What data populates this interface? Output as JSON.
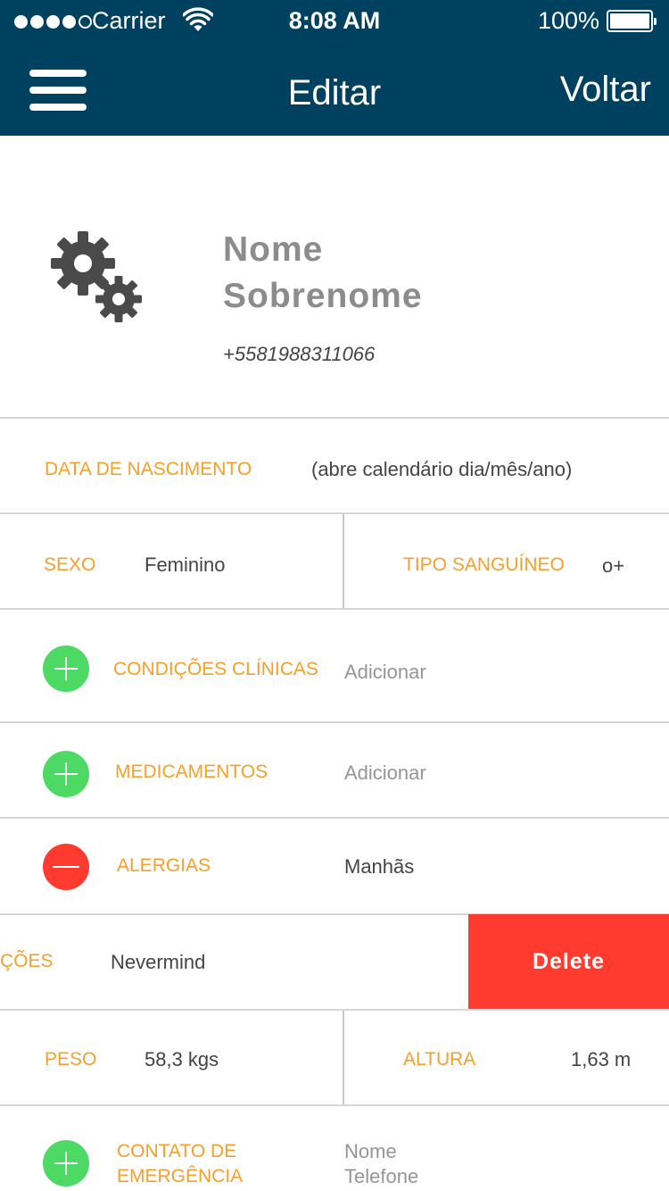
{
  "status_bar": {
    "carrier": "Carrier",
    "time": "8:08 AM",
    "battery": "100%"
  },
  "nav": {
    "title": "Editar",
    "back_label": "Voltar"
  },
  "profile": {
    "first_name": "Nome",
    "last_name": "Sobrenome",
    "phone": "+5581988311066",
    "icon": "gears-icon"
  },
  "birth_date": {
    "label": "DATA DE NASCIMENTO",
    "value": "(abre calendário dia/mês/ano)"
  },
  "sex": {
    "label": "SEXO",
    "value": "Feminino"
  },
  "blood_type": {
    "label": "TIPO SANGUÍNEO",
    "value": "o+"
  },
  "clinical_conditions": {
    "label": "CONDIÇÕES CLÍNICAS",
    "value": "Adicionar"
  },
  "medications": {
    "label": "MEDICAMENTOS",
    "value": "Adicionar"
  },
  "allergies": {
    "label": "ALERGIAS",
    "value": "Manhãs"
  },
  "swiped_row": {
    "label": "ÇÕES",
    "value": "Nevermind",
    "delete_label": "Delete"
  },
  "weight": {
    "label": "PESO",
    "value": "58,3 kgs"
  },
  "height": {
    "label": "ALTURA",
    "value": "1,63 m"
  },
  "emergency_contact": {
    "label_line1": "CONTATO DE",
    "label_line2": "EMERGÊNCIA",
    "name_placeholder": "Nome",
    "phone_placeholder": "Telefone"
  },
  "colors": {
    "header_bg": "#00415f",
    "label_orange": "#f5a02a",
    "add_green": "#4cd964",
    "remove_red": "#ff3b30",
    "delete_red": "#ff3b30"
  }
}
